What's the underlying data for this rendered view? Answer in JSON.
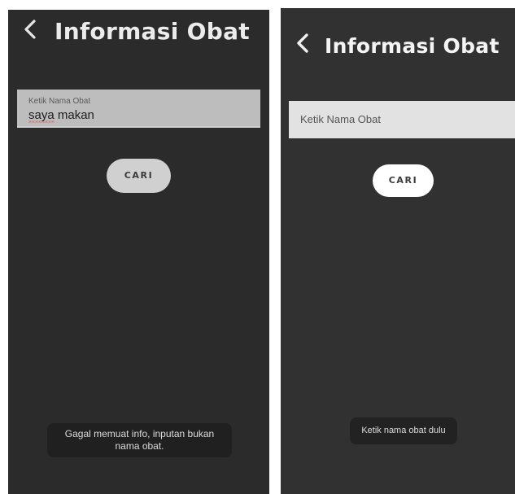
{
  "left_screen": {
    "title": "Informasi Obat",
    "search_field": {
      "label": "Ketik Nama Obat",
      "value_misspelled": "saya",
      "value_rest": " makan"
    },
    "search_button_label": "CARI",
    "toast_line1": "Gagal memuat info, inputan bukan",
    "toast_line2": "nama obat."
  },
  "right_screen": {
    "title": "Informasi Obat",
    "search_field": {
      "placeholder": "Ketik Nama Obat"
    },
    "search_button_label": "CARI",
    "toast": "Ketik nama obat dulu"
  },
  "colors": {
    "background": "#2b2b2b",
    "field_left": "#bdbdbd",
    "field_right": "#e2e2e2",
    "button_left": "#d0d0d0",
    "button_right": "#ffffff",
    "spellcheck_underline": "#e0453a"
  },
  "icons": {
    "back": "chevron-left-icon"
  }
}
